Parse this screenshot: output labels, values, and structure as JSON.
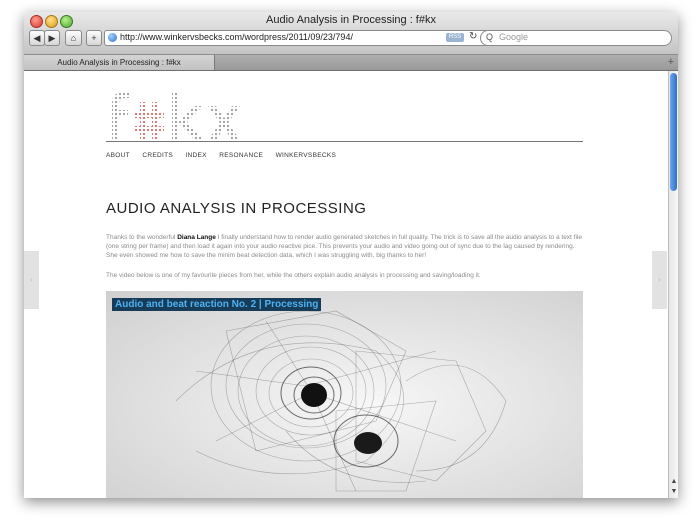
{
  "window": {
    "title": "Audio Analysis in Processing : f#kx"
  },
  "toolbar": {
    "back_label": "◀",
    "forward_label": "▶",
    "home_label": "⌂",
    "add_label": "+",
    "url": "http://www.winkervsbecks.com/wordpress/2011/09/23/794/",
    "rss_label": "RSS",
    "reload_label": "↻",
    "search_placeholder": "Google",
    "search_icon_label": "Q"
  },
  "tabs": [
    {
      "label": "Audio Analysis in Processing : f#kx"
    }
  ],
  "tab_add_label": "+",
  "site": {
    "logo_text": "f#kx",
    "nav": [
      "ABOUT",
      "CREDITS",
      "INDEX",
      "RESONANCE",
      "WINKERVSBECKS"
    ]
  },
  "article": {
    "title": "AUDIO ANALYSIS IN PROCESSING",
    "para1_before": "Thanks to the wonderful ",
    "para1_link": "Diana Lange",
    "para1_after": " I finally understand how to render audio generated sketches in full quality. The trick is to save all the audio analysis to a text file (one string per frame) and then load it again into your audio reactive pice. This prevents your audio and video going out of sync due to the lag caused by rendering. She even showed me how to save the minim beat detection data, which I was struggling with, big thanks to her!",
    "para2": "The video below is one of my favourite pieces from her, while the others explain audio analysis in processing and saving/loading it.",
    "video_title": "Audio and beat reaction No. 2 | Processing"
  },
  "nav_arrows": {
    "left": "‹",
    "right": "›"
  },
  "scrollbar": {
    "up": "▲",
    "down": "▼"
  }
}
